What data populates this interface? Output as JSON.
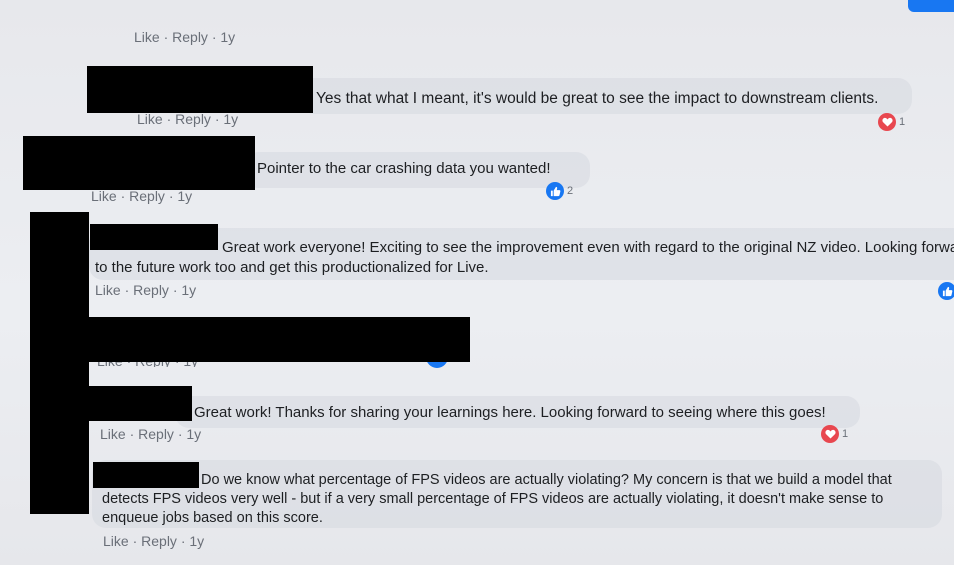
{
  "comments": [
    {
      "text": "",
      "meta": {
        "like": "Like",
        "reply": "Reply",
        "time": "1y"
      }
    },
    {
      "text": "Yes that what I meant, it's would be great to see the impact to downstream clients.",
      "meta": {
        "like": "Like",
        "reply": "Reply",
        "time": "1y"
      },
      "reaction": {
        "type": "heart",
        "count": "1"
      }
    },
    {
      "text": "Pointer to the car crashing data you wanted!",
      "meta": {
        "like": "Like",
        "reply": "Reply",
        "time": "1y"
      },
      "reaction": {
        "type": "like",
        "count": "2"
      }
    },
    {
      "text": "Great work everyone! Exciting to see the improvement even with regard to the original NZ video. Looking forward to the future work too and get this productionalized for Live.",
      "meta": {
        "like": "Like",
        "reply": "Reply",
        "time": "1y"
      },
      "reaction": {
        "type": "like",
        "count": ""
      }
    },
    {
      "text": "",
      "meta": {
        "like": "Like",
        "reply": "Reply",
        "time": "1y"
      }
    },
    {
      "text": "Great work! Thanks for sharing your learnings here. Looking forward to seeing where this goes!",
      "meta": {
        "like": "Like",
        "reply": "Reply",
        "time": "1y"
      },
      "reaction": {
        "type": "heart",
        "count": "1"
      }
    },
    {
      "text": "Do we know what percentage of FPS videos are actually violating? My concern is that we build a model that detects FPS videos very well - but if a very small percentage of FPS videos are actually violating, it doesn't make sense to enqueue jobs based on this score.",
      "meta": {
        "like": "Like",
        "reply": "Reply",
        "time": "1y"
      }
    }
  ],
  "separator": "·",
  "colors": {
    "accent": "#1877f2",
    "heart": "#e8474f",
    "redaction": "#000000"
  }
}
